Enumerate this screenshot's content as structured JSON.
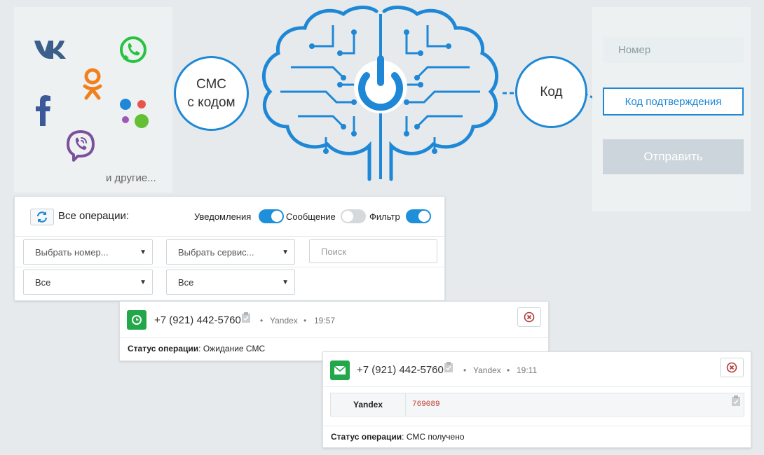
{
  "left_panel": {
    "more_label": "и другие..."
  },
  "diagram": {
    "sms_circle": "СМС\nс кодом",
    "code_circle": "Код"
  },
  "right_panel": {
    "number_placeholder": "Номер",
    "code_button": "Код подтверждения",
    "send_button": "Отправить"
  },
  "operations": {
    "title": "Все операции:",
    "toggles": [
      {
        "label": "Уведомления",
        "on": true
      },
      {
        "label": "Сообщение",
        "on": false
      },
      {
        "label": "Фильтр",
        "on": true
      }
    ],
    "filters": {
      "number_select": "Выбрать номер...",
      "service_select": "Выбрать сервис...",
      "search_placeholder": "Поиск",
      "status_select_1": "Все",
      "status_select_2": "Все"
    }
  },
  "cards": [
    {
      "phone": "+7 (921) 442-5760",
      "service": "Yandex",
      "time": "19:57",
      "status_label": "Статус операции",
      "status_value": ": Ожидание СМС",
      "icon": "clock-icon"
    },
    {
      "phone": "+7 (921) 442-5760",
      "service": "Yandex",
      "time": "19:11",
      "message_service": "Yandex",
      "message_code": "769089",
      "status_label": "Статус операции",
      "status_value": ": СМС получено",
      "icon": "envelope-icon"
    }
  ],
  "colors": {
    "accent": "#1e88d7",
    "success": "#22a84a",
    "danger": "#b23a3a"
  }
}
